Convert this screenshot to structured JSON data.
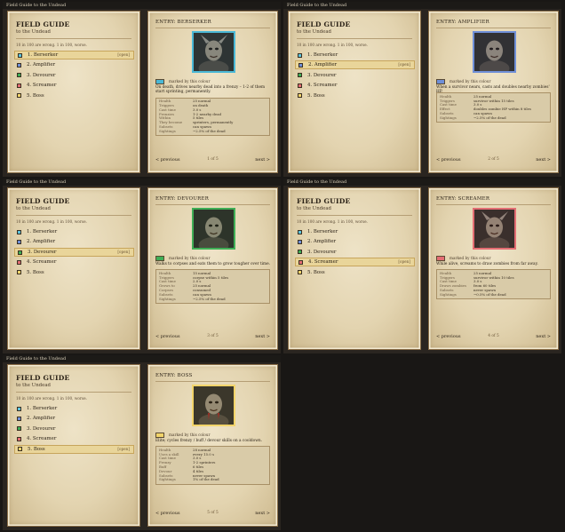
{
  "window_title": "Field Guide to the Undead",
  "guide": {
    "title": "FIELD GUIDE",
    "subtitle": "to the Undead",
    "note": "10 in 100 are wrong. 1 in 100, worse.",
    "items": [
      {
        "label": "1.  Berserker",
        "color": "#5bc4de"
      },
      {
        "label": "2.  Amplifier",
        "color": "#6f8fd8"
      },
      {
        "label": "3.  Devourer",
        "color": "#3fae56"
      },
      {
        "label": "4.  Screamer",
        "color": "#e36d73"
      },
      {
        "label": "5.  Boss",
        "color": "#f2d46a"
      }
    ],
    "open_label": "[open]",
    "legend_text": "marked by this colour",
    "prev_label": "<  previous",
    "next_label": "next  >"
  },
  "entries": [
    {
      "entry_label": "ENTRY:  BERSERKER",
      "selected": 0,
      "color": "#4ab8d6",
      "description": "On death, drives nearby dead into a frenzy – 1-2 of them start sprinting, permanently.",
      "stats": [
        {
          "k": "Health",
          "v": "25 normal"
        },
        {
          "k": "Triggers",
          "v": "on death"
        },
        {
          "k": "Cast time",
          "v": "3.0 s"
        },
        {
          "k": "Frenzies",
          "v": "1-2 nearby dead"
        },
        {
          "k": "Within",
          "v": "5 tiles"
        },
        {
          "k": "They become",
          "v": "sprinters, permanently"
        },
        {
          "k": "Subsets",
          "v": "can spawn"
        },
        {
          "k": "Sightings",
          "v": "~2.5% of the dead"
        }
      ],
      "page_num": "1 of 5"
    },
    {
      "entry_label": "ENTRY:  AMPLIFIER",
      "selected": 1,
      "color": "#6f8fd8",
      "description": "When a survivor nears, casts and doubles nearby zombies' HP.",
      "stats": [
        {
          "k": "Health",
          "v": "25 normal"
        },
        {
          "k": "Triggers",
          "v": "survivor within 15 tiles"
        },
        {
          "k": "Cast time",
          "v": "3.0 s"
        },
        {
          "k": "Effect",
          "v": "doubles zombie HP within 8 tiles"
        },
        {
          "k": "Subsets",
          "v": "can spawn"
        },
        {
          "k": "Sightings",
          "v": "~2.5% of the dead"
        }
      ],
      "page_num": "2 of 5"
    },
    {
      "entry_label": "ENTRY:  DEVOURER",
      "selected": 2,
      "color": "#3fae56",
      "description": "Walks to corpses and eats them to grow tougher over time.",
      "stats": [
        {
          "k": "Health",
          "v": "15 normal"
        },
        {
          "k": "Triggers",
          "v": "corpse within 5 tiles"
        },
        {
          "k": "Cast time",
          "v": "2.0 s"
        },
        {
          "k": "Grows to",
          "v": "25 normal"
        },
        {
          "k": "Corpses",
          "v": "consumed"
        },
        {
          "k": "Subsets",
          "v": "can spawn"
        },
        {
          "k": "Sightings",
          "v": "~2.5% of the dead"
        }
      ],
      "page_num": "3 of 5"
    },
    {
      "entry_label": "ENTRY:  SCREAMER",
      "selected": 3,
      "color": "#e36d73",
      "description": "While alive, screams to draw zombies from far away.",
      "stats": [
        {
          "k": "Health",
          "v": "25 normal"
        },
        {
          "k": "Triggers",
          "v": "survivor within 10 tiles"
        },
        {
          "k": "Cast time",
          "v": "3.0 s"
        },
        {
          "k": "Draws zombies",
          "v": "from 60 tiles"
        },
        {
          "k": "Subsets",
          "v": "never spawn"
        },
        {
          "k": "Sightings",
          "v": "~0.5% of the dead"
        }
      ],
      "page_num": "4 of 5"
    },
    {
      "entry_label": "ENTRY:  BOSS",
      "selected": 4,
      "color": "#f2d46a",
      "description": "Elite; cycles frenzy / buff / devour skills on a cooldown.",
      "stats": [
        {
          "k": "Health",
          "v": "28 normal"
        },
        {
          "k": "Uses a skill",
          "v": "every 15.0 s"
        },
        {
          "k": "Cast time",
          "v": "3.0 s"
        },
        {
          "k": "Frenzy",
          "v": "1-2 sprinters"
        },
        {
          "k": "Buff",
          "v": "6 tiles"
        },
        {
          "k": "Devour",
          "v": "4 tiles"
        },
        {
          "k": "Subsets",
          "v": "never spawn"
        },
        {
          "k": "Sightings",
          "v": "1% of the dead"
        }
      ],
      "page_num": "5 of 5"
    }
  ]
}
